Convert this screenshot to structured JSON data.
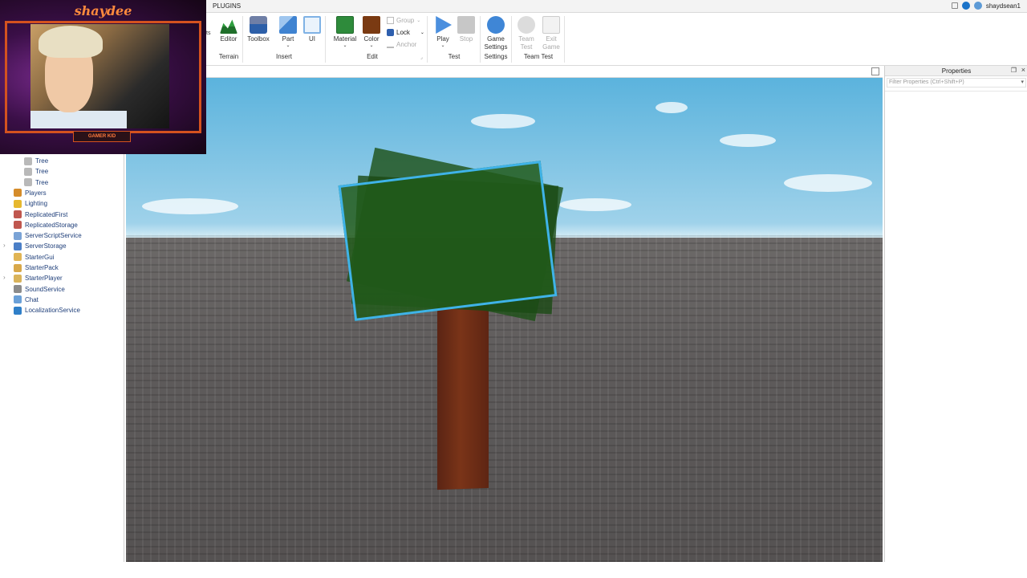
{
  "ribbon": {
    "tab": "PLUGINS",
    "user": "shaydsean1",
    "tools": {
      "editor": "Editor",
      "toolbox": "Toolbox",
      "part": "Part",
      "ui": "UI",
      "material": "Material",
      "color": "Color",
      "group": "Group",
      "lock": "Lock",
      "anchor": "Anchor",
      "play": "Play",
      "stop": "Stop",
      "game_settings_1": "Game",
      "game_settings_2": "Settings",
      "team_test_1": "Team",
      "team_test_2": "Test",
      "exit_game_1": "Exit",
      "exit_game_2": "Game"
    },
    "groups": {
      "terrain": "Terrain",
      "insert": "Insert",
      "edit": "Edit",
      "test": "Test",
      "settings": "Settings",
      "team_test": "Team Test"
    },
    "partial_text": "ts"
  },
  "webcam": {
    "name": "shaydee",
    "tag": "GAMER KID"
  },
  "explorer": {
    "items": [
      {
        "label": "Tree",
        "indent": 2,
        "icon": "model-icon"
      },
      {
        "label": "Tree",
        "indent": 2,
        "icon": "model-icon"
      },
      {
        "label": "Tree",
        "indent": 2,
        "icon": "model-icon"
      },
      {
        "label": "Players",
        "indent": 1,
        "icon": "players-icon"
      },
      {
        "label": "Lighting",
        "indent": 1,
        "icon": "lighting-icon"
      },
      {
        "label": "ReplicatedFirst",
        "indent": 1,
        "icon": "replicated-first-icon"
      },
      {
        "label": "ReplicatedStorage",
        "indent": 1,
        "icon": "replicated-storage-icon"
      },
      {
        "label": "ServerScriptService",
        "indent": 1,
        "icon": "server-script-service-icon"
      },
      {
        "label": "ServerStorage",
        "indent": 1,
        "icon": "server-storage-icon"
      },
      {
        "label": "StarterGui",
        "indent": 1,
        "icon": "starter-gui-icon"
      },
      {
        "label": "StarterPack",
        "indent": 1,
        "icon": "starter-pack-icon"
      },
      {
        "label": "StarterPlayer",
        "indent": 1,
        "icon": "starter-player-icon"
      },
      {
        "label": "SoundService",
        "indent": 1,
        "icon": "sound-service-icon"
      },
      {
        "label": "Chat",
        "indent": 1,
        "icon": "chat-icon"
      },
      {
        "label": "LocalizationService",
        "indent": 1,
        "icon": "localization-service-icon"
      }
    ]
  },
  "properties": {
    "title": "Properties",
    "filter_placeholder": "Filter Properties (Ctrl+Shift+P)"
  },
  "colors": {
    "selection": "#3fb3e8",
    "leaves": "#215a1a",
    "trunk": "#7a3418",
    "accent_orange": "#d4521f"
  }
}
